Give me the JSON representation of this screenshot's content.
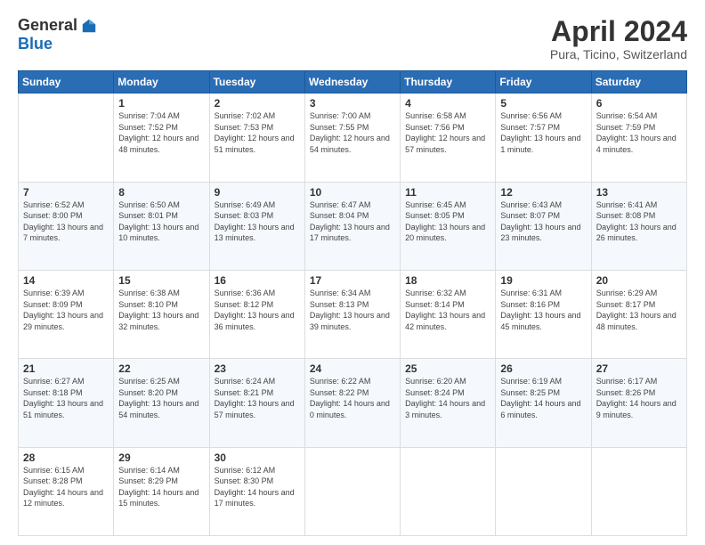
{
  "header": {
    "logo_general": "General",
    "logo_blue": "Blue",
    "title": "April 2024",
    "location": "Pura, Ticino, Switzerland"
  },
  "weekdays": [
    "Sunday",
    "Monday",
    "Tuesday",
    "Wednesday",
    "Thursday",
    "Friday",
    "Saturday"
  ],
  "weeks": [
    [
      {
        "day": "",
        "sunrise": "",
        "sunset": "",
        "daylight": ""
      },
      {
        "day": "1",
        "sunrise": "Sunrise: 7:04 AM",
        "sunset": "Sunset: 7:52 PM",
        "daylight": "Daylight: 12 hours and 48 minutes."
      },
      {
        "day": "2",
        "sunrise": "Sunrise: 7:02 AM",
        "sunset": "Sunset: 7:53 PM",
        "daylight": "Daylight: 12 hours and 51 minutes."
      },
      {
        "day": "3",
        "sunrise": "Sunrise: 7:00 AM",
        "sunset": "Sunset: 7:55 PM",
        "daylight": "Daylight: 12 hours and 54 minutes."
      },
      {
        "day": "4",
        "sunrise": "Sunrise: 6:58 AM",
        "sunset": "Sunset: 7:56 PM",
        "daylight": "Daylight: 12 hours and 57 minutes."
      },
      {
        "day": "5",
        "sunrise": "Sunrise: 6:56 AM",
        "sunset": "Sunset: 7:57 PM",
        "daylight": "Daylight: 13 hours and 1 minute."
      },
      {
        "day": "6",
        "sunrise": "Sunrise: 6:54 AM",
        "sunset": "Sunset: 7:59 PM",
        "daylight": "Daylight: 13 hours and 4 minutes."
      }
    ],
    [
      {
        "day": "7",
        "sunrise": "Sunrise: 6:52 AM",
        "sunset": "Sunset: 8:00 PM",
        "daylight": "Daylight: 13 hours and 7 minutes."
      },
      {
        "day": "8",
        "sunrise": "Sunrise: 6:50 AM",
        "sunset": "Sunset: 8:01 PM",
        "daylight": "Daylight: 13 hours and 10 minutes."
      },
      {
        "day": "9",
        "sunrise": "Sunrise: 6:49 AM",
        "sunset": "Sunset: 8:03 PM",
        "daylight": "Daylight: 13 hours and 13 minutes."
      },
      {
        "day": "10",
        "sunrise": "Sunrise: 6:47 AM",
        "sunset": "Sunset: 8:04 PM",
        "daylight": "Daylight: 13 hours and 17 minutes."
      },
      {
        "day": "11",
        "sunrise": "Sunrise: 6:45 AM",
        "sunset": "Sunset: 8:05 PM",
        "daylight": "Daylight: 13 hours and 20 minutes."
      },
      {
        "day": "12",
        "sunrise": "Sunrise: 6:43 AM",
        "sunset": "Sunset: 8:07 PM",
        "daylight": "Daylight: 13 hours and 23 minutes."
      },
      {
        "day": "13",
        "sunrise": "Sunrise: 6:41 AM",
        "sunset": "Sunset: 8:08 PM",
        "daylight": "Daylight: 13 hours and 26 minutes."
      }
    ],
    [
      {
        "day": "14",
        "sunrise": "Sunrise: 6:39 AM",
        "sunset": "Sunset: 8:09 PM",
        "daylight": "Daylight: 13 hours and 29 minutes."
      },
      {
        "day": "15",
        "sunrise": "Sunrise: 6:38 AM",
        "sunset": "Sunset: 8:10 PM",
        "daylight": "Daylight: 13 hours and 32 minutes."
      },
      {
        "day": "16",
        "sunrise": "Sunrise: 6:36 AM",
        "sunset": "Sunset: 8:12 PM",
        "daylight": "Daylight: 13 hours and 36 minutes."
      },
      {
        "day": "17",
        "sunrise": "Sunrise: 6:34 AM",
        "sunset": "Sunset: 8:13 PM",
        "daylight": "Daylight: 13 hours and 39 minutes."
      },
      {
        "day": "18",
        "sunrise": "Sunrise: 6:32 AM",
        "sunset": "Sunset: 8:14 PM",
        "daylight": "Daylight: 13 hours and 42 minutes."
      },
      {
        "day": "19",
        "sunrise": "Sunrise: 6:31 AM",
        "sunset": "Sunset: 8:16 PM",
        "daylight": "Daylight: 13 hours and 45 minutes."
      },
      {
        "day": "20",
        "sunrise": "Sunrise: 6:29 AM",
        "sunset": "Sunset: 8:17 PM",
        "daylight": "Daylight: 13 hours and 48 minutes."
      }
    ],
    [
      {
        "day": "21",
        "sunrise": "Sunrise: 6:27 AM",
        "sunset": "Sunset: 8:18 PM",
        "daylight": "Daylight: 13 hours and 51 minutes."
      },
      {
        "day": "22",
        "sunrise": "Sunrise: 6:25 AM",
        "sunset": "Sunset: 8:20 PM",
        "daylight": "Daylight: 13 hours and 54 minutes."
      },
      {
        "day": "23",
        "sunrise": "Sunrise: 6:24 AM",
        "sunset": "Sunset: 8:21 PM",
        "daylight": "Daylight: 13 hours and 57 minutes."
      },
      {
        "day": "24",
        "sunrise": "Sunrise: 6:22 AM",
        "sunset": "Sunset: 8:22 PM",
        "daylight": "Daylight: 14 hours and 0 minutes."
      },
      {
        "day": "25",
        "sunrise": "Sunrise: 6:20 AM",
        "sunset": "Sunset: 8:24 PM",
        "daylight": "Daylight: 14 hours and 3 minutes."
      },
      {
        "day": "26",
        "sunrise": "Sunrise: 6:19 AM",
        "sunset": "Sunset: 8:25 PM",
        "daylight": "Daylight: 14 hours and 6 minutes."
      },
      {
        "day": "27",
        "sunrise": "Sunrise: 6:17 AM",
        "sunset": "Sunset: 8:26 PM",
        "daylight": "Daylight: 14 hours and 9 minutes."
      }
    ],
    [
      {
        "day": "28",
        "sunrise": "Sunrise: 6:15 AM",
        "sunset": "Sunset: 8:28 PM",
        "daylight": "Daylight: 14 hours and 12 minutes."
      },
      {
        "day": "29",
        "sunrise": "Sunrise: 6:14 AM",
        "sunset": "Sunset: 8:29 PM",
        "daylight": "Daylight: 14 hours and 15 minutes."
      },
      {
        "day": "30",
        "sunrise": "Sunrise: 6:12 AM",
        "sunset": "Sunset: 8:30 PM",
        "daylight": "Daylight: 14 hours and 17 minutes."
      },
      {
        "day": "",
        "sunrise": "",
        "sunset": "",
        "daylight": ""
      },
      {
        "day": "",
        "sunrise": "",
        "sunset": "",
        "daylight": ""
      },
      {
        "day": "",
        "sunrise": "",
        "sunset": "",
        "daylight": ""
      },
      {
        "day": "",
        "sunrise": "",
        "sunset": "",
        "daylight": ""
      }
    ]
  ]
}
